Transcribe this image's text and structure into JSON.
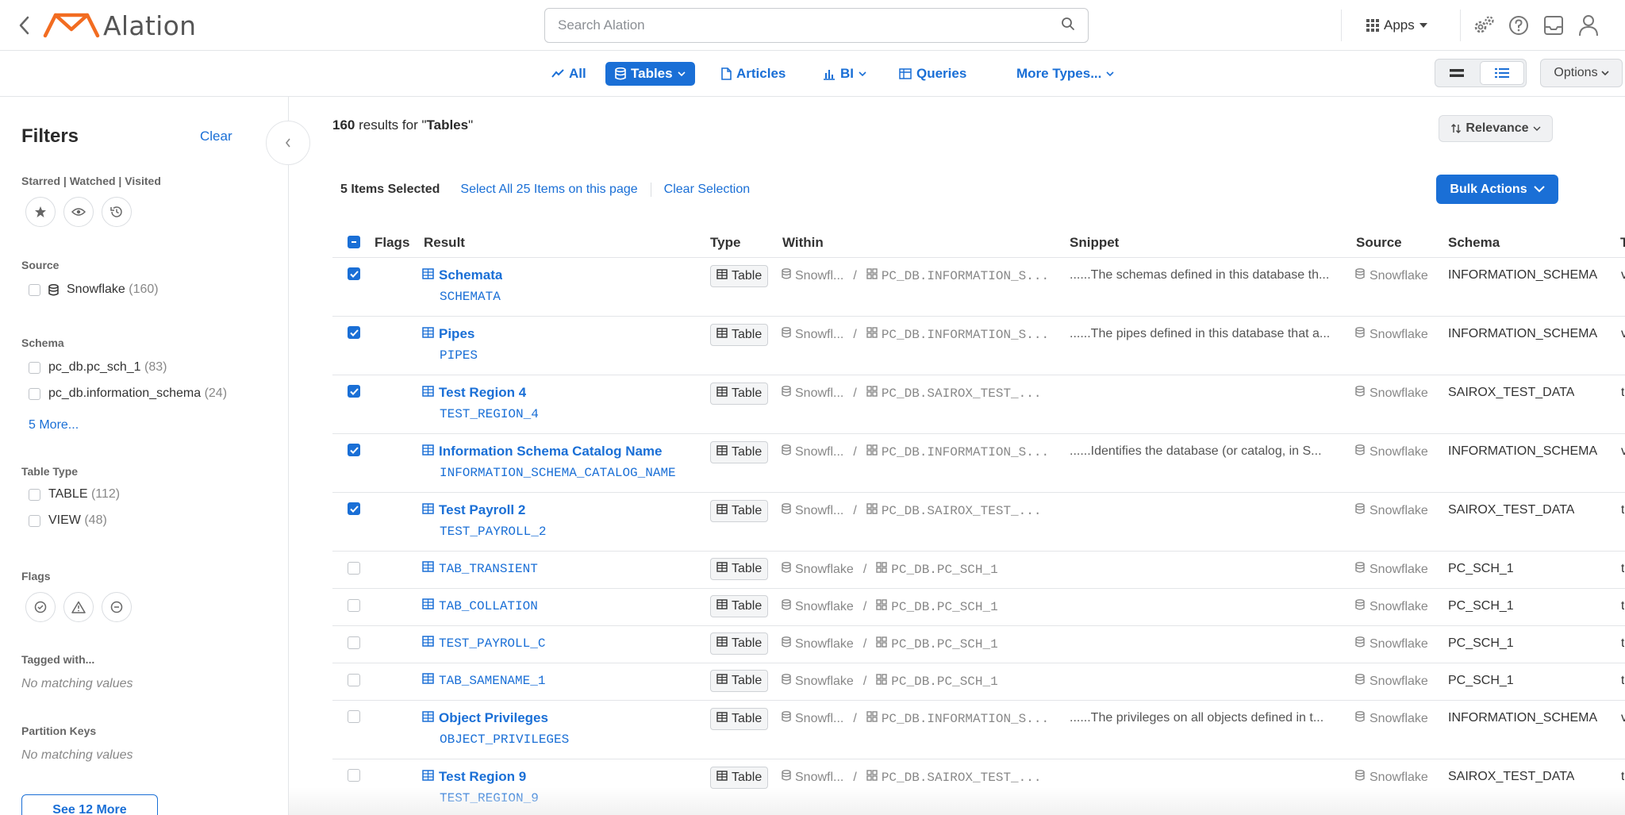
{
  "header": {
    "app_name": "Alation",
    "search_placeholder": "Search Alation",
    "apps_label": "Apps"
  },
  "typebar": {
    "tabs": [
      {
        "label": "All",
        "icon": "trend-icon"
      },
      {
        "label": "Tables",
        "icon": "database-icon",
        "active": true
      },
      {
        "label": "Articles",
        "icon": "document-icon"
      },
      {
        "label": "BI",
        "icon": "bar-chart-icon"
      },
      {
        "label": "Queries",
        "icon": "query-grid-icon"
      },
      {
        "label": "More Types...",
        "icon": "chevron-down-icon"
      }
    ],
    "options_label": "Options"
  },
  "filters": {
    "title": "Filters",
    "clear_label": "Clear",
    "starred_section": "Starred | Watched | Visited",
    "source_section": "Source",
    "source_options": [
      {
        "label": "Snowflake",
        "count": "(160)"
      }
    ],
    "schema_section": "Schema",
    "schema_options": [
      {
        "label": "pc_db.pc_sch_1",
        "count": "(83)"
      },
      {
        "label": "pc_db.information_schema",
        "count": "(24)"
      }
    ],
    "schema_more": "5 More...",
    "table_type_section": "Table Type",
    "table_type_options": [
      {
        "label": "TABLE",
        "count": "(112)"
      },
      {
        "label": "VIEW",
        "count": "(48)"
      }
    ],
    "flags_section": "Flags",
    "tagged_section": "Tagged with...",
    "tagged_empty": "No matching values",
    "partition_section": "Partition Keys",
    "partition_empty": "No matching values",
    "see_more_label": "See 12 More"
  },
  "results": {
    "count": "160",
    "count_suffix": " results for \"",
    "query": "Tables",
    "count_close": "\"",
    "sort_label": "Relevance",
    "selected_label": "5 Items Selected",
    "select_all_label": "Select All 25 Items on this page",
    "clear_selection_label": "Clear Selection",
    "bulk_actions_label": "Bulk Actions",
    "columns": {
      "flags": "Flags",
      "result": "Result",
      "type": "Type",
      "within": "Within",
      "snippet": "Snippet",
      "source": "Source",
      "schema": "Schema",
      "edge": "T"
    },
    "rows": [
      {
        "checked": true,
        "title": "Schemata",
        "sub": "SCHEMATA",
        "type": "Table",
        "within_source": "Snowfl...",
        "within_schema": "PC_DB.INFORMATION_S...",
        "snippet": "......The schemas defined in this database th...",
        "source": "Snowflake",
        "schema": "INFORMATION_SCHEMA",
        "edge": "v"
      },
      {
        "checked": true,
        "title": "Pipes",
        "sub": "PIPES",
        "type": "Table",
        "within_source": "Snowfl...",
        "within_schema": "PC_DB.INFORMATION_S...",
        "snippet": "......The pipes defined in this database that a...",
        "source": "Snowflake",
        "schema": "INFORMATION_SCHEMA",
        "edge": "v"
      },
      {
        "checked": true,
        "title": "Test Region 4",
        "sub": "TEST_REGION_4",
        "type": "Table",
        "within_source": "Snowfl...",
        "within_schema": "PC_DB.SAIROX_TEST_...",
        "snippet": "",
        "source": "Snowflake",
        "schema": "SAIROX_TEST_DATA",
        "edge": "t"
      },
      {
        "checked": true,
        "title": "Information Schema Catalog Name",
        "sub": "INFORMATION_SCHEMA_CATALOG_NAME",
        "type": "Table",
        "within_source": "Snowfl...",
        "within_schema": "PC_DB.INFORMATION_S...",
        "snippet": "......Identifies the database (or catalog, in S...",
        "source": "Snowflake",
        "schema": "INFORMATION_SCHEMA",
        "edge": "v"
      },
      {
        "checked": true,
        "title": "Test Payroll 2",
        "sub": "TEST_PAYROLL_2",
        "type": "Table",
        "within_source": "Snowfl...",
        "within_schema": "PC_DB.SAIROX_TEST_...",
        "snippet": "",
        "source": "Snowflake",
        "schema": "SAIROX_TEST_DATA",
        "edge": "t"
      },
      {
        "checked": false,
        "title": "TAB_TRANSIENT",
        "sub": "",
        "type": "Table",
        "within_source": "Snowflake",
        "within_schema": "PC_DB.PC_SCH_1",
        "snippet": "",
        "source": "Snowflake",
        "schema": "PC_SCH_1",
        "edge": "t"
      },
      {
        "checked": false,
        "title": "TAB_COLLATION",
        "sub": "",
        "type": "Table",
        "within_source": "Snowflake",
        "within_schema": "PC_DB.PC_SCH_1",
        "snippet": "",
        "source": "Snowflake",
        "schema": "PC_SCH_1",
        "edge": "t"
      },
      {
        "checked": false,
        "title": "TEST_PAYROLL_C",
        "sub": "",
        "type": "Table",
        "within_source": "Snowflake",
        "within_schema": "PC_DB.PC_SCH_1",
        "snippet": "",
        "source": "Snowflake",
        "schema": "PC_SCH_1",
        "edge": "t"
      },
      {
        "checked": false,
        "title": "TAB_SAMENAME_1",
        "sub": "",
        "type": "Table",
        "within_source": "Snowflake",
        "within_schema": "PC_DB.PC_SCH_1",
        "snippet": "",
        "source": "Snowflake",
        "schema": "PC_SCH_1",
        "edge": "t"
      },
      {
        "checked": false,
        "title": "Object Privileges",
        "sub": "OBJECT_PRIVILEGES",
        "type": "Table",
        "within_source": "Snowfl...",
        "within_schema": "PC_DB.INFORMATION_S...",
        "snippet": "......The privileges on all objects defined in t...",
        "source": "Snowflake",
        "schema": "INFORMATION_SCHEMA",
        "edge": "v"
      },
      {
        "checked": false,
        "title": "Test Region 9",
        "sub": "TEST_REGION_9",
        "type": "Table",
        "within_source": "Snowfl...",
        "within_schema": "PC_DB.SAIROX_TEST_...",
        "snippet": "",
        "source": "Snowflake",
        "schema": "SAIROX_TEST_DATA",
        "edge": "t"
      }
    ]
  },
  "colors": {
    "accent": "#1a6fd6",
    "logo_orange": "#f26c21"
  }
}
